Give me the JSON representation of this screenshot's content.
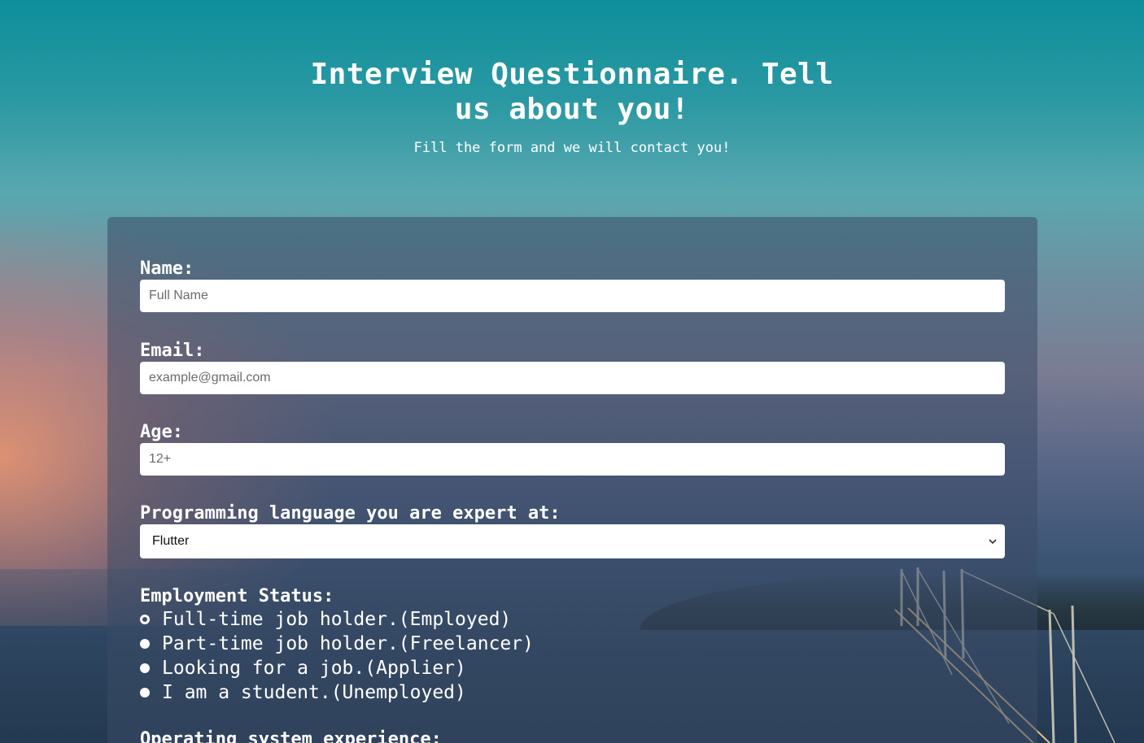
{
  "header": {
    "title": "Interview Questionnaire. Tell us about you!",
    "subtitle": "Fill the form and we will contact you!"
  },
  "form": {
    "name": {
      "label": "Name:",
      "placeholder": "Full Name"
    },
    "email": {
      "label": "Email:",
      "placeholder": "example@gmail.com"
    },
    "age": {
      "label": "Age:",
      "placeholder": "12+"
    },
    "language": {
      "label": "Programming language you are expert at:",
      "selected": "Flutter"
    },
    "employment": {
      "label": "Employment Status:",
      "options": [
        "Full-time job holder.(Employed)",
        "Part-time job holder.(Freelancer)",
        "Looking for a job.(Applier)",
        "I am a student.(Unemployed)"
      ]
    },
    "os": {
      "label": "Operating system experience:"
    }
  }
}
